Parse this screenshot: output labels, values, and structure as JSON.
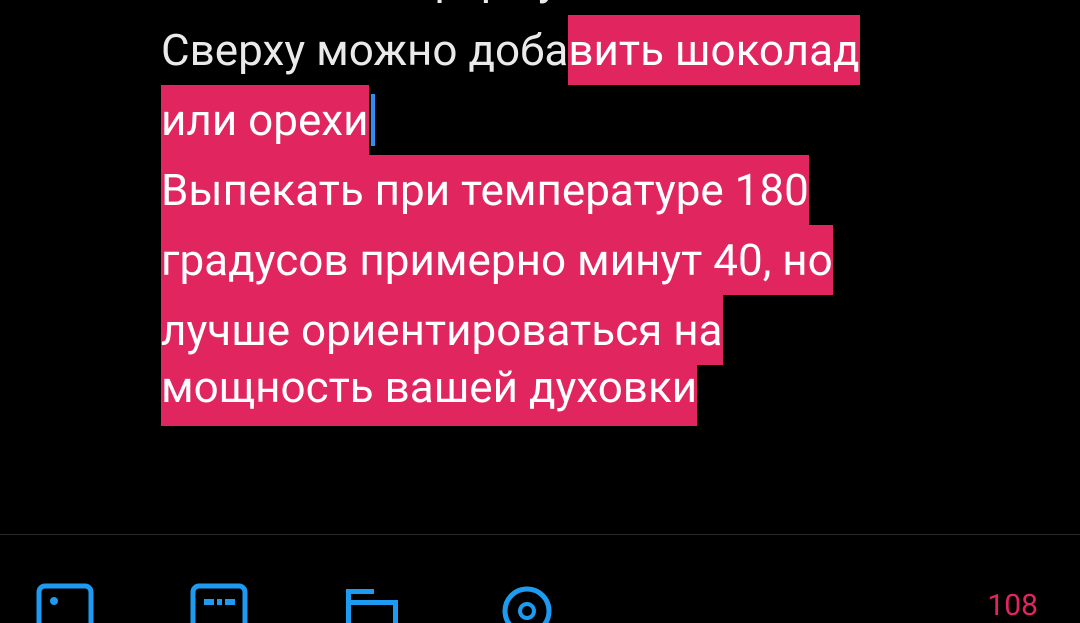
{
  "editor": {
    "previous_line": "Выложить в форму",
    "lines": [
      {
        "plain": "Сверху можно доба",
        "selected": "вить шоколад"
      },
      {
        "plain": "",
        "selected": "или орехи "
      },
      {
        "plain": "",
        "selected": "Выпекать при температуре 180"
      },
      {
        "plain": "",
        "selected": "градусов примерно минут 40, но"
      },
      {
        "plain": "",
        "selected": "лучше ориентироваться на"
      },
      {
        "plain": "",
        "selected": "мощность вашей духовки "
      }
    ]
  },
  "toolbar": {
    "counter": "108",
    "icons": [
      "image-icon",
      "gif-icon",
      "poll-icon",
      "location-icon"
    ]
  },
  "colors": {
    "background": "#000000",
    "text": "#eaeaea",
    "selection": "#e1255f",
    "caret": "#2f8ff0",
    "toolbar_icon": "#1d9bf0"
  }
}
